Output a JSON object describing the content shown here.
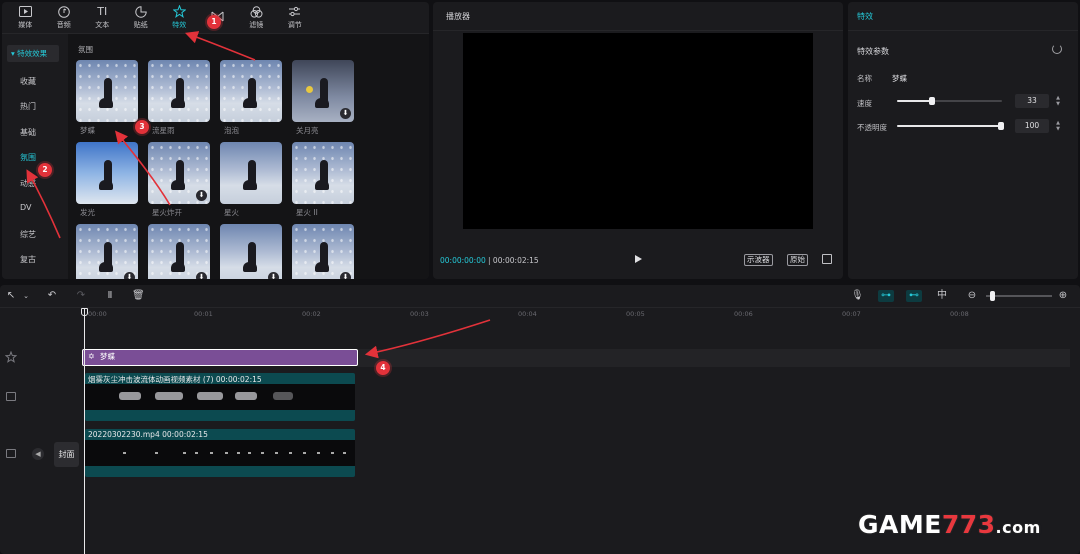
{
  "toolbar": {
    "tabs": [
      {
        "label": "媒体",
        "icon": "media-icon"
      },
      {
        "label": "音频",
        "icon": "audio-icon"
      },
      {
        "label": "文本",
        "icon": "text-icon",
        "glyph": "TI"
      },
      {
        "label": "贴纸",
        "icon": "sticker-icon"
      },
      {
        "label": "特效",
        "icon": "effects-icon"
      },
      {
        "label": "",
        "icon": "transition-icon"
      },
      {
        "label": "滤镜",
        "icon": "filter-icon"
      },
      {
        "label": "调节",
        "icon": "adjust-icon"
      }
    ],
    "active_tab": "特效"
  },
  "sidebar": {
    "header": "特效效果",
    "items": [
      "收藏",
      "热门",
      "基础",
      "氛围",
      "动感",
      "DV",
      "综艺",
      "复古"
    ],
    "active": "氛围"
  },
  "effects_grid": {
    "section_title": "氛围",
    "items": [
      {
        "label": "梦蝶",
        "downloadable": false
      },
      {
        "label": "流星雨",
        "downloadable": false
      },
      {
        "label": "泡泡",
        "downloadable": false
      },
      {
        "label": "关月亮",
        "downloadable": true
      },
      {
        "label": "发光",
        "downloadable": false
      },
      {
        "label": "星火炸开",
        "downloadable": true
      },
      {
        "label": "星火",
        "downloadable": false
      },
      {
        "label": "星火 II",
        "downloadable": false
      },
      {
        "label": "",
        "downloadable": true
      },
      {
        "label": "",
        "downloadable": true
      },
      {
        "label": "",
        "downloadable": true
      },
      {
        "label": "",
        "downloadable": true
      }
    ]
  },
  "player": {
    "title": "播放器",
    "current_time": "00:00:00:00",
    "duration": "00:00:02:15",
    "scope_button": "示波器",
    "original_button": "原始"
  },
  "properties": {
    "title": "特效",
    "section": "特效参数",
    "name_label": "名称",
    "name_value": "梦蝶",
    "speed_label": "速度",
    "speed_value": "33",
    "opacity_label": "不透明度",
    "opacity_value": "100"
  },
  "timeline": {
    "ruler": [
      "00:00",
      "00:01",
      "00:02",
      "00:03",
      "00:04",
      "00:05",
      "00:06",
      "00:07",
      "00:08"
    ],
    "effect_clip": "梦蝶",
    "video_clip_1": "烟雾灰尘冲击波流体动画视频素材 (7)    00:00:02:15",
    "video_clip_2": "20220302230.mp4    00:00:02:15",
    "cover_label": "封面"
  },
  "annotations": [
    "1",
    "2",
    "3",
    "4"
  ],
  "watermark": {
    "prefix": "GAME",
    "number": "773",
    "suffix": ".com"
  },
  "colors": {
    "accent": "#25c9d8",
    "effect_clip": "#7a4e96",
    "video_clip": "#0c4a50",
    "badge": "#e2323a"
  }
}
